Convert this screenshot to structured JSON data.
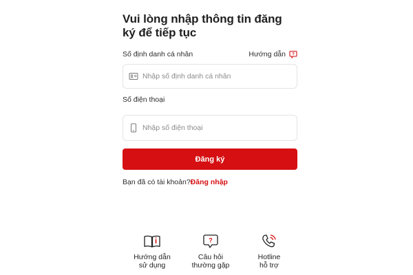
{
  "form": {
    "title": "Vui lòng nhập thông tin đăng ký để tiếp tục",
    "id_label": "Số định danh cá nhân",
    "help_label": "Hướng dẫn",
    "id_placeholder": "Nhập số định danh cá nhân",
    "phone_label": "Số điện thoại",
    "phone_placeholder": "Nhập số điện thoại",
    "submit_label": "Đăng ký",
    "have_account_text": "Bạn đã có tài khoản?",
    "login_link": "Đăng nhập"
  },
  "bottom_nav": {
    "items": [
      {
        "label": "Hướng dẫn\nsử dụng",
        "icon": "book-icon"
      },
      {
        "label": "Câu hỏi\nthường gặp",
        "icon": "question-bubble-icon"
      },
      {
        "label": "Hotline\nhỗ trợ",
        "icon": "phone-ringing-icon"
      }
    ]
  },
  "colors": {
    "accent": "#d50f12",
    "text": "#1f1f1f",
    "border": "#e3e3e3",
    "placeholder": "#8a8a8a"
  }
}
